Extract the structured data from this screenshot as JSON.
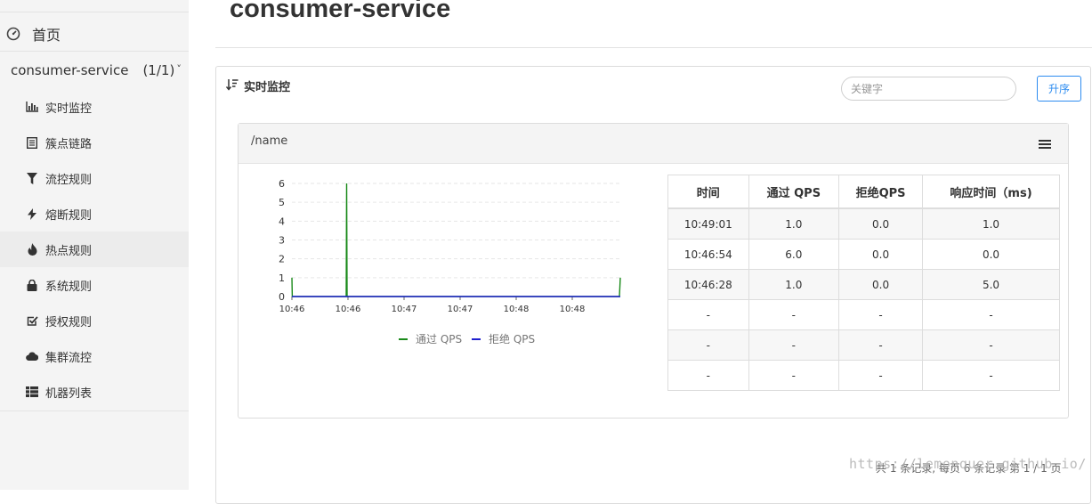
{
  "sidebar": {
    "home_label": "首页",
    "app": {
      "name": "consumer-service",
      "count": "(1/1)"
    },
    "items": [
      {
        "label": "实时监控",
        "icon": "bar-chart-icon"
      },
      {
        "label": "簇点链路",
        "icon": "list-icon"
      },
      {
        "label": "流控规则",
        "icon": "filter-icon"
      },
      {
        "label": "熔断规则",
        "icon": "bolt-icon"
      },
      {
        "label": "热点规则",
        "icon": "fire-icon"
      },
      {
        "label": "系统规则",
        "icon": "lock-icon"
      },
      {
        "label": "授权规则",
        "icon": "check-square-icon"
      },
      {
        "label": "集群流控",
        "icon": "cloud-icon"
      },
      {
        "label": "机器列表",
        "icon": "grid-icon"
      }
    ]
  },
  "header": {
    "title": "consumer-service"
  },
  "panel": {
    "title": "实时监控",
    "search_placeholder": "关键字",
    "sort_button": "升序"
  },
  "card": {
    "resource": "/name",
    "table": {
      "headers": [
        "时间",
        "通过 QPS",
        "拒绝QPS",
        "响应时间（ms)"
      ],
      "rows": [
        [
          "10:49:01",
          "1.0",
          "0.0",
          "1.0"
        ],
        [
          "10:46:54",
          "6.0",
          "0.0",
          "0.0"
        ],
        [
          "10:46:28",
          "1.0",
          "0.0",
          "5.0"
        ],
        [
          "-",
          "-",
          "-",
          "-"
        ],
        [
          "-",
          "-",
          "-",
          "-"
        ],
        [
          "-",
          "-",
          "-",
          "-"
        ]
      ]
    }
  },
  "chart_data": {
    "type": "line",
    "x_tick_labels": [
      "10:46",
      "10:46",
      "10:47",
      "10:47",
      "10:48",
      "10:48"
    ],
    "y_ticks": [
      0,
      1,
      2,
      3,
      4,
      5,
      6
    ],
    "ylim": [
      0,
      6
    ],
    "legend_position": "bottom",
    "colors": {
      "pass": "#1a8a1a",
      "block": "#1f1fcf"
    },
    "series": [
      {
        "name": "通过 QPS",
        "points": [
          [
            0,
            1
          ],
          [
            0.4,
            0
          ],
          [
            61,
            0
          ],
          [
            61.5,
            6
          ],
          [
            62,
            0
          ],
          [
            63,
            0
          ],
          [
            368,
            0
          ],
          [
            369,
            1
          ]
        ]
      },
      {
        "name": "拒绝 QPS",
        "points": [
          [
            0,
            0
          ],
          [
            369,
            0
          ]
        ]
      }
    ],
    "x_range": [
      0,
      369
    ]
  },
  "footer": {
    "pagination": "共 1 条记录, 每页 6 条记录 第 1 / 1 页",
    "watermark": "https://lemonquer.github.io/"
  }
}
